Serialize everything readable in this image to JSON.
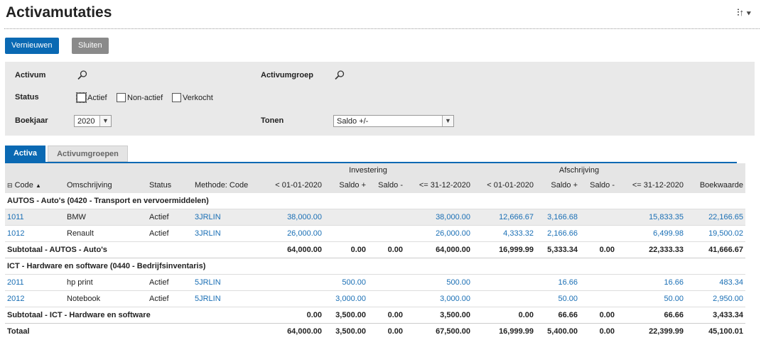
{
  "page": {
    "title": "Activamutaties",
    "menu_icon": "settings-menu-icon"
  },
  "toolbar": {
    "refresh_label": "Vernieuwen",
    "close_label": "Sluiten"
  },
  "filters": {
    "activum_label": "Activum",
    "activumgroep_label": "Activumgroep",
    "status_label": "Status",
    "status_options": [
      "Actief",
      "Non-actief",
      "Verkocht"
    ],
    "boekjaar_label": "Boekjaar",
    "boekjaar_value": "2020",
    "tonen_label": "Tonen",
    "tonen_value": "Saldo +/-"
  },
  "tabs": [
    "Activa",
    "Activumgroepen"
  ],
  "table": {
    "group_headers": {
      "investering": "Investering",
      "afschrijving": "Afschrijving"
    },
    "columns": [
      "Code",
      "Omschrijving",
      "Status",
      "Methode: Code",
      "< 01-01-2020",
      "Saldo +",
      "Saldo -",
      "<= 31-12-2020",
      "< 01-01-2020",
      "Saldo +",
      "Saldo -",
      "<= 31-12-2020",
      "Boekwaarde"
    ],
    "groups": [
      {
        "title": "AUTOS - Auto's (0420 - Transport en vervoermiddelen)",
        "rows": [
          [
            "1011",
            "BMW",
            "Actief",
            "3JRLIN",
            "38,000.00",
            "",
            "",
            "38,000.00",
            "12,666.67",
            "3,166.68",
            "",
            "15,833.35",
            "22,166.65"
          ],
          [
            "1012",
            "Renault",
            "Actief",
            "3JRLIN",
            "26,000.00",
            "",
            "",
            "26,000.00",
            "4,333.32",
            "2,166.66",
            "",
            "6,499.98",
            "19,500.02"
          ]
        ],
        "subtotal": [
          "Subtotaal - AUTOS - Auto's",
          "64,000.00",
          "0.00",
          "0.00",
          "64,000.00",
          "16,999.99",
          "5,333.34",
          "0.00",
          "22,333.33",
          "41,666.67"
        ]
      },
      {
        "title": "ICT - Hardware en software (0440 - Bedrijfsinventaris)",
        "rows": [
          [
            "2011",
            "hp print",
            "Actief",
            "5JRLIN",
            "",
            "500.00",
            "",
            "500.00",
            "",
            "16.66",
            "",
            "16.66",
            "483.34"
          ],
          [
            "2012",
            "Notebook",
            "Actief",
            "5JRLIN",
            "",
            "3,000.00",
            "",
            "3,000.00",
            "",
            "50.00",
            "",
            "50.00",
            "2,950.00"
          ]
        ],
        "subtotal": [
          "Subtotaal - ICT - Hardware en software",
          "0.00",
          "3,500.00",
          "0.00",
          "3,500.00",
          "0.00",
          "66.66",
          "0.00",
          "66.66",
          "3,433.34"
        ]
      }
    ],
    "total": [
      "Totaal",
      "64,000.00",
      "3,500.00",
      "0.00",
      "67,500.00",
      "16,999.99",
      "5,400.00",
      "0.00",
      "22,399.99",
      "45,100.01"
    ]
  }
}
